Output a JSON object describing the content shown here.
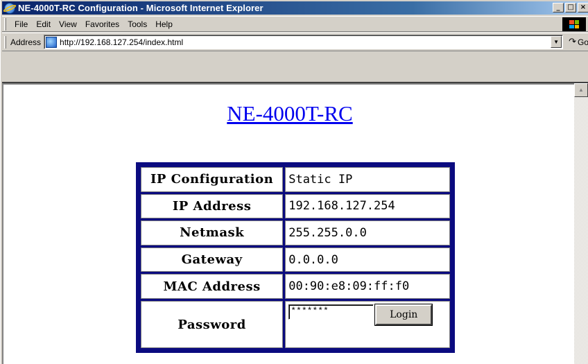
{
  "window": {
    "title": "NE-4000T-RC Configuration - Microsoft Internet Explorer",
    "buttons": {
      "minimize": "_",
      "maximize": "□",
      "close": "×"
    }
  },
  "menu": {
    "items": [
      "File",
      "Edit",
      "View",
      "Favorites",
      "Tools",
      "Help"
    ]
  },
  "address_bar": {
    "label": "Address",
    "url": "http://192.168.127.254/index.html",
    "go_label": "Go"
  },
  "page": {
    "heading": "NE-4000T-RC",
    "rows": [
      {
        "label": "IP Configuration",
        "value": "Static IP"
      },
      {
        "label": "IP Address",
        "value": "192.168.127.254"
      },
      {
        "label": "Netmask",
        "value": "255.255.0.0"
      },
      {
        "label": "Gateway",
        "value": "0.0.0.0"
      },
      {
        "label": "MAC Address",
        "value": "00:90:e8:09:ff:f0"
      }
    ],
    "password": {
      "label": "Password",
      "value": "*******",
      "button": "Login"
    }
  },
  "colors": {
    "titlebar_start": "#0a246a",
    "titlebar_end": "#a6caf0",
    "link": "#0000ee",
    "table_border": "#0b0b80",
    "chrome": "#d4d0c8"
  },
  "icons": {
    "browser": "ie-logo-icon",
    "address": "page-ie-icon",
    "go": "go-arrow-icon",
    "windows": "windows-logo-icon",
    "scroll_up": "scroll-up-arrow-icon"
  }
}
